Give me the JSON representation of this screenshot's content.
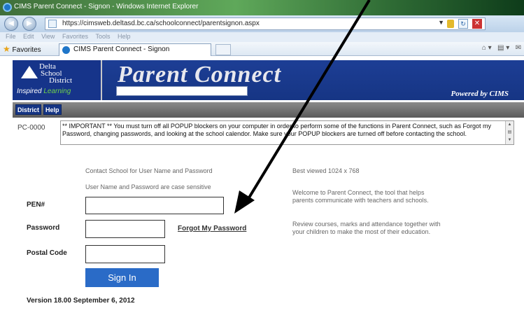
{
  "browser": {
    "window_title": "CIMS Parent Connect - Signon - Windows Internet Explorer",
    "url": "https://cimsweb.deltasd.bc.ca/schoolconnect/parentsignon.aspx",
    "menu": [
      "File",
      "Edit",
      "View",
      "Favorites",
      "Tools",
      "Help"
    ],
    "favorites_label": "Favorites",
    "tab_label": "CIMS Parent Connect - Signon"
  },
  "header": {
    "logo_line1": "Delta",
    "logo_line2": "School",
    "logo_line3": "District",
    "tagline_a": "Inspired",
    "tagline_b": "Learning",
    "title": "Parent Connect",
    "powered": "Powered by CIMS"
  },
  "nav": {
    "district": "District",
    "help": "Help"
  },
  "notice": {
    "code": "PC-0000",
    "text": "** IMPORTANT ** You must turn off all POPUP blockers on your computer in order to perform some of the functions in Parent Connect, such as Forgot my Password, changing passwords, and looking at the school calendor. Make sure your POPUP blockers are turned off before contacting the school."
  },
  "form": {
    "contact": "Contact School for User Name and Password",
    "case": "User Name and Password are case sensitive",
    "pen_label": "PEN#",
    "password_label": "Password",
    "postal_label": "Postal Code",
    "forgot": "Forgot My Password",
    "signin": "Sign In"
  },
  "side": {
    "best_viewed": "Best viewed 1024 x 768",
    "welcome": "Welcome to Parent Connect, the tool that helps parents communicate with teachers and schools.",
    "review": "Review courses, marks and attendance together with your children to make the most of their education."
  },
  "version": "Version 18.00 September 6, 2012",
  "colors": {
    "banner": "#16348a",
    "signin": "#2a6bc7",
    "accent_green": "#6fd24a"
  }
}
